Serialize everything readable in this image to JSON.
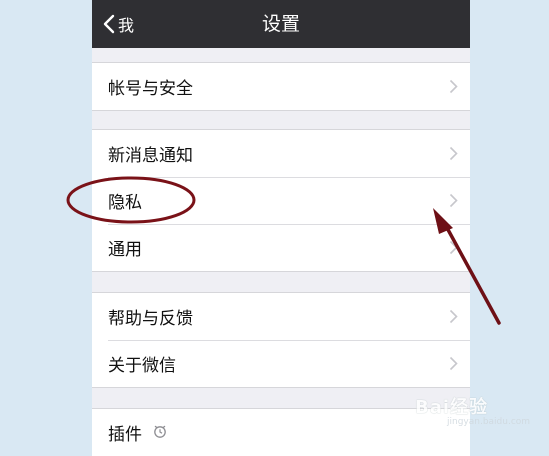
{
  "navbar": {
    "back_label": "我",
    "title": "设置"
  },
  "groups": [
    {
      "items": [
        {
          "label": "帐号与安全"
        }
      ]
    },
    {
      "items": [
        {
          "label": "新消息通知"
        },
        {
          "label": "隐私"
        },
        {
          "label": "通用"
        }
      ]
    },
    {
      "items": [
        {
          "label": "帮助与反馈"
        },
        {
          "label": "关于微信"
        }
      ]
    },
    {
      "items": [
        {
          "label": "插件"
        }
      ]
    }
  ],
  "watermark": {
    "brand": "Bai经验",
    "url": "jingyan.baidu.com"
  },
  "colors": {
    "navbar": "#2f2f33",
    "background": "#efeff4",
    "annotation": "#7a1218",
    "page": "#d9e8f3"
  }
}
